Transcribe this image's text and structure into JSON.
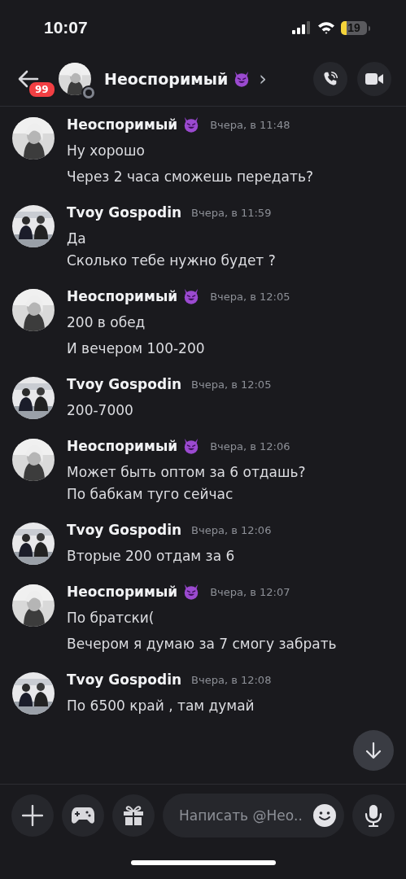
{
  "status_bar": {
    "time": "10:07",
    "battery": "19"
  },
  "header": {
    "unread_badge": "99",
    "name": "Неоспоримый",
    "emoji": true,
    "chevron": "›"
  },
  "messages": [
    {
      "author": "Неоспоримый",
      "emoji": true,
      "kind": "portrait",
      "time": "Вчера, в 11:48",
      "messages": [
        [
          "Ну хорошо"
        ],
        [
          "Через 2 часа сможешь передать?"
        ]
      ]
    },
    {
      "author": "Tvoy Gospodin",
      "emoji": false,
      "kind": "duo",
      "time": "Вчера, в 11:59",
      "messages": [
        [
          "Да",
          "Сколько тебе нужно будет ?"
        ]
      ]
    },
    {
      "author": "Неоспоримый",
      "emoji": true,
      "kind": "portrait",
      "time": "Вчера, в 12:05",
      "messages": [
        [
          "200 в обед"
        ],
        [
          "И вечером 100-200"
        ]
      ]
    },
    {
      "author": "Tvoy Gospodin",
      "emoji": false,
      "kind": "duo",
      "time": "Вчера, в 12:05",
      "messages": [
        [
          "200-7000"
        ]
      ]
    },
    {
      "author": "Неоспоримый",
      "emoji": true,
      "kind": "portrait",
      "time": "Вчера, в 12:06",
      "messages": [
        [
          "Может быть оптом за 6 отдашь?",
          "По бабкам туго сейчас"
        ]
      ]
    },
    {
      "author": "Tvoy Gospodin",
      "emoji": false,
      "kind": "duo",
      "time": "Вчера, в 12:06",
      "messages": [
        [
          "Вторые 200 отдам за 6"
        ]
      ]
    },
    {
      "author": "Неоспоримый",
      "emoji": true,
      "kind": "portrait",
      "time": "Вчера, в 12:07",
      "messages": [
        [
          "По братски("
        ],
        [
          "Вечером я думаю за 7 смогу забрать"
        ]
      ]
    },
    {
      "author": "Tvoy Gospodin",
      "emoji": false,
      "kind": "duo",
      "time": "Вчера, в 12:08",
      "messages": [
        [
          "По 6500 край , там думай"
        ]
      ]
    }
  ],
  "composer": {
    "placeholder": "Написать @Нео.."
  }
}
